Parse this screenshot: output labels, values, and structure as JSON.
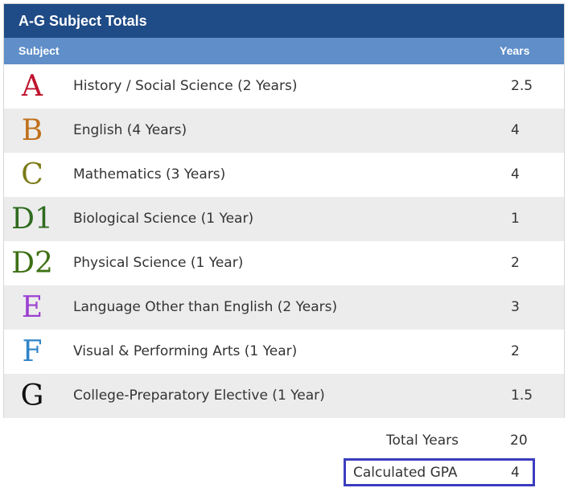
{
  "panel": {
    "title": "A-G Subject Totals",
    "columns": {
      "subject": "Subject",
      "years": "Years"
    }
  },
  "rows": [
    {
      "letter": "A",
      "subject": "History / Social Science (2 Years)",
      "years": "2.5",
      "color": "#c0142e"
    },
    {
      "letter": "B",
      "subject": "English (4 Years)",
      "years": "4",
      "color": "#c0701a"
    },
    {
      "letter": "C",
      "subject": "Mathematics (3 Years)",
      "years": "4",
      "color": "#7b7a16"
    },
    {
      "letter": "D1",
      "subject": "Biological Science (1 Year)",
      "years": "1",
      "color": "#2e6b1f"
    },
    {
      "letter": "D2",
      "subject": "Physical Science (1 Year)",
      "years": "2",
      "color": "#3d6f12"
    },
    {
      "letter": "E",
      "subject": "Language Other than English (2 Years)",
      "years": "3",
      "color": "#9b3fd1"
    },
    {
      "letter": "F",
      "subject": "Visual & Performing Arts (1 Year)",
      "years": "2",
      "color": "#2f84c8"
    },
    {
      "letter": "G",
      "subject": "College-Preparatory Elective (1 Year)",
      "years": "1.5",
      "color": "#111111"
    }
  ],
  "summary": {
    "total_label": "Total Years",
    "total_value": "20",
    "gpa_label": "Calculated GPA",
    "gpa_value": "4",
    "gpa_border_color": "#3b3dbf"
  },
  "colors": {
    "title_bg": "#1f4b86",
    "header_bg": "#5f8ec9",
    "alt_row_bg": "#ececec"
  }
}
